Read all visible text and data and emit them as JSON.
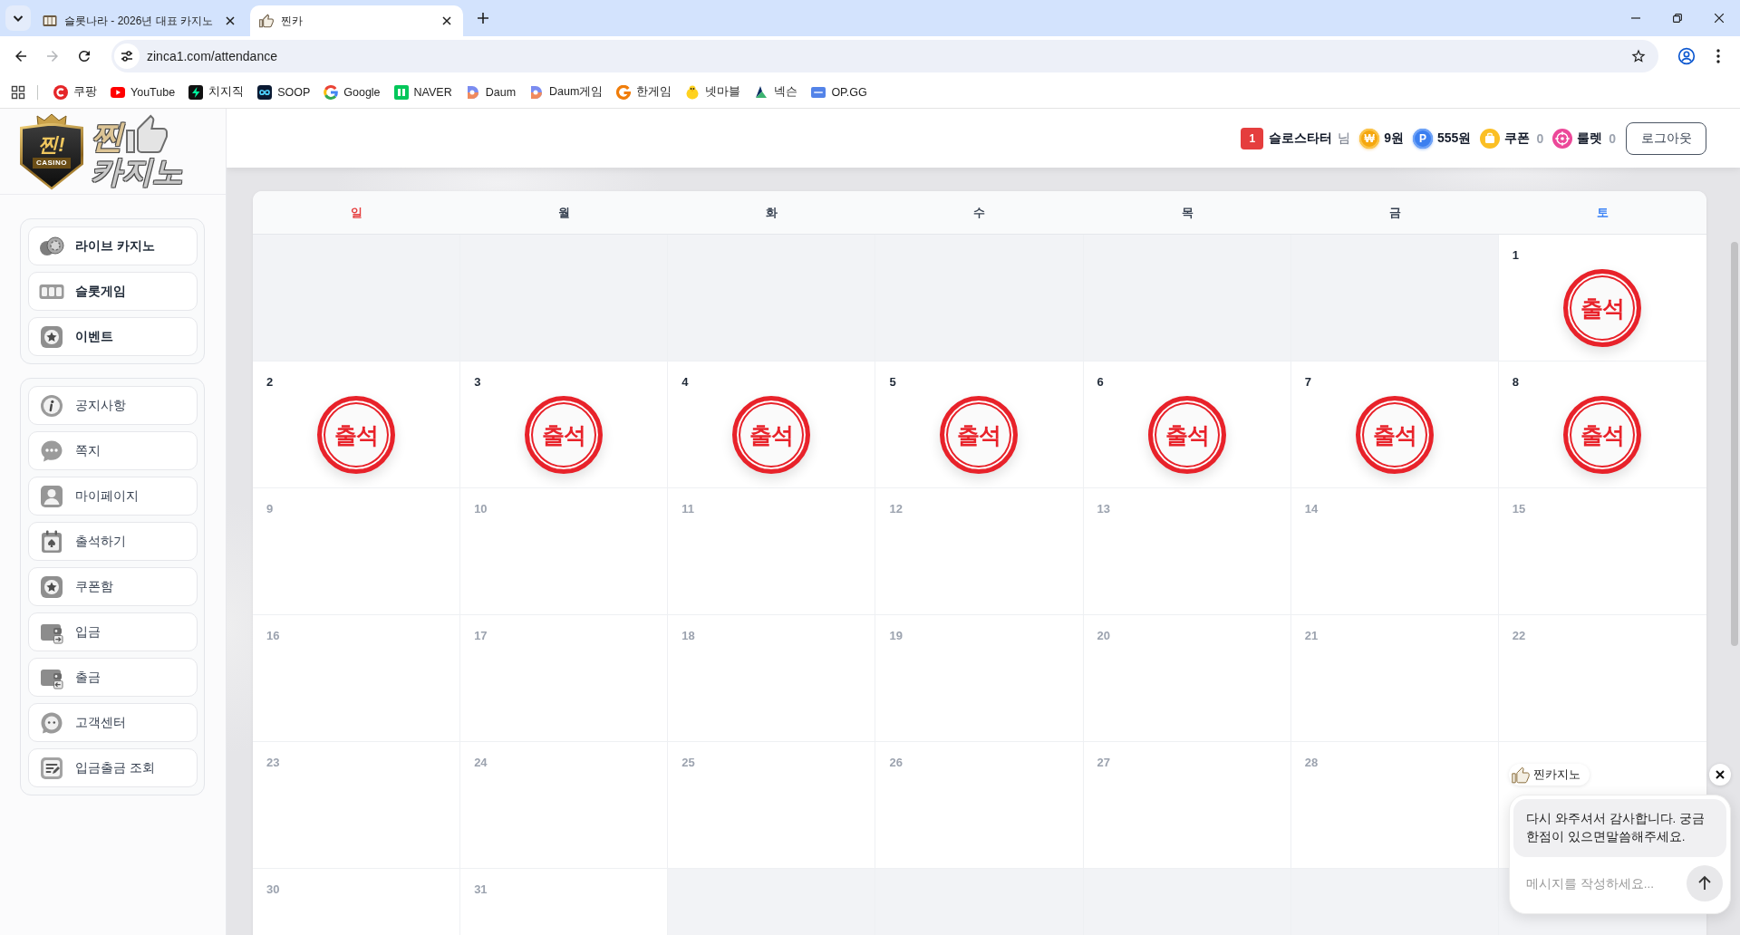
{
  "browser": {
    "tabs": [
      {
        "title": "슬롯나라 - 2026년 대표 카지노",
        "selected": false
      },
      {
        "title": "찐카",
        "selected": true
      }
    ],
    "back": {
      "disabled": false
    },
    "forward": {
      "disabled": true
    },
    "address": "zinca1.com/attendance",
    "bookmarks": [
      "쿠팡",
      "YouTube",
      "치지직",
      "SOOP",
      "Google",
      "NAVER",
      "Daum",
      "Daum게임",
      "한게임",
      "넷마블",
      "넥슨",
      "OP.GG"
    ]
  },
  "logo": {
    "badge_title": "찐!",
    "badge_caption": "CASINO",
    "title_lines": [
      "찐",
      "카지노"
    ]
  },
  "sidebar": {
    "groups": [
      {
        "kind": "games",
        "items": [
          "라이브 카지노",
          "슬롯게임",
          "이벤트"
        ]
      },
      {
        "kind": "menu",
        "items": [
          "공지사항",
          "쪽지",
          "마이페이지",
          "출석하기",
          "쿠폰함",
          "입금",
          "출금",
          "고객센터",
          "입금출금 조회"
        ]
      }
    ]
  },
  "header": {
    "level": "1",
    "username": "슬로스타터",
    "honorific": "님",
    "wallet": [
      {
        "kind": "won",
        "symbol": "₩",
        "value": "9원"
      },
      {
        "kind": "point",
        "symbol": "P",
        "value": "555원"
      },
      {
        "kind": "coupon",
        "label": "쿠폰",
        "count": "0"
      },
      {
        "kind": "roulette",
        "label": "룰렛",
        "count": "0"
      }
    ],
    "logout": "로그아웃"
  },
  "calendar": {
    "weekdays": [
      {
        "label": "일",
        "color": "#e53e3e"
      },
      {
        "label": "월",
        "color": "#374151"
      },
      {
        "label": "화",
        "color": "#374151"
      },
      {
        "label": "수",
        "color": "#374151"
      },
      {
        "label": "목",
        "color": "#374151"
      },
      {
        "label": "금",
        "color": "#374151"
      },
      {
        "label": "토",
        "color": "#3b82f6"
      }
    ],
    "weeks": [
      [
        {
          "in_month": false
        },
        {
          "in_month": false
        },
        {
          "in_month": false
        },
        {
          "in_month": false
        },
        {
          "in_month": false
        },
        {
          "in_month": false
        },
        {
          "in_month": true,
          "day": "1",
          "stamp": "출석"
        }
      ],
      [
        {
          "in_month": true,
          "day": "2",
          "stamp": "출석"
        },
        {
          "in_month": true,
          "day": "3",
          "stamp": "출석"
        },
        {
          "in_month": true,
          "day": "4",
          "stamp": "출석"
        },
        {
          "in_month": true,
          "day": "5",
          "stamp": "출석"
        },
        {
          "in_month": true,
          "day": "6",
          "stamp": "출석"
        },
        {
          "in_month": true,
          "day": "7",
          "stamp": "출석"
        },
        {
          "in_month": true,
          "day": "8",
          "stamp": "출석"
        }
      ],
      [
        {
          "in_month": true,
          "day": "9"
        },
        {
          "in_month": true,
          "day": "10"
        },
        {
          "in_month": true,
          "day": "11"
        },
        {
          "in_month": true,
          "day": "12"
        },
        {
          "in_month": true,
          "day": "13"
        },
        {
          "in_month": true,
          "day": "14"
        },
        {
          "in_month": true,
          "day": "15"
        }
      ],
      [
        {
          "in_month": true,
          "day": "16"
        },
        {
          "in_month": true,
          "day": "17"
        },
        {
          "in_month": true,
          "day": "18"
        },
        {
          "in_month": true,
          "day": "19"
        },
        {
          "in_month": true,
          "day": "20"
        },
        {
          "in_month": true,
          "day": "21"
        },
        {
          "in_month": true,
          "day": "22"
        }
      ],
      [
        {
          "in_month": true,
          "day": "23"
        },
        {
          "in_month": true,
          "day": "24"
        },
        {
          "in_month": true,
          "day": "25"
        },
        {
          "in_month": true,
          "day": "26"
        },
        {
          "in_month": true,
          "day": "27"
        },
        {
          "in_month": true,
          "day": "28"
        },
        {
          "in_month": true
        }
      ],
      [
        {
          "in_month": true,
          "day": "30"
        },
        {
          "in_month": true,
          "day": "31"
        },
        {
          "in_month": false
        },
        {
          "in_month": false
        },
        {
          "in_month": false
        },
        {
          "in_month": false
        },
        {
          "in_month": false
        }
      ]
    ]
  },
  "chat": {
    "name": "찐카지노",
    "message": "다시 와주셔서 감사합니다. 궁금한점이 있으면말씀해주세요.",
    "placeholder": "메시지를 작성하세요..."
  }
}
